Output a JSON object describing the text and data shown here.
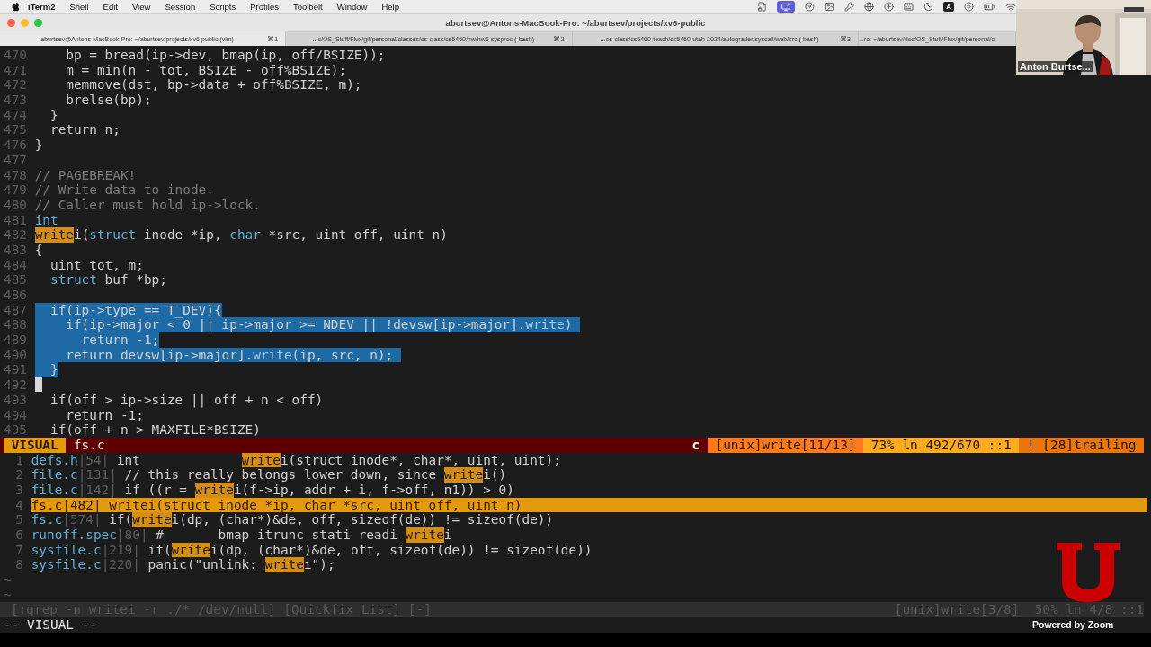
{
  "menu_bar": {
    "app": "iTerm2",
    "items": [
      "Shell",
      "Edit",
      "View",
      "Session",
      "Scripts",
      "Profiles",
      "Toolbelt",
      "Window",
      "Help"
    ],
    "input_source": "A"
  },
  "window": {
    "title": "aburtsev@Antons-MacBook-Pro: ~/aburtsev/projects/xv6-public",
    "tabs": [
      {
        "label": "aburtsev@Antons-MacBook-Pro: ~/aburtsev/projects/xv6-public (vim)",
        "shortcut": "⌘1",
        "selected": true
      },
      {
        "label": "...c/OS_Stuff/Flux/git/personal/classes/os-class/cs5460/hw/hw6-sysproc (-bash)",
        "shortcut": "⌘2",
        "selected": false
      },
      {
        "label": "...os-class/cs5460-teach/cs5460-utah-2024/autograder/syscall/web/src (-bash)",
        "shortcut": "⌘3",
        "selected": false
      },
      {
        "label": "...ro: ~/aburtsev/doc/OS_Stuff/Flux/git/personal/c",
        "selected": false
      }
    ]
  },
  "video": {
    "name": "Anton Burtse..."
  },
  "editor": {
    "lines": [
      {
        "number": "470",
        "selected": false,
        "cursor": false,
        "segments": [
          {
            "kind": "plain",
            "text": "    bp = bread(ip->dev, bmap(ip, off/BSIZE));"
          }
        ]
      },
      {
        "number": "471",
        "selected": false,
        "cursor": false,
        "segments": [
          {
            "kind": "plain",
            "text": "    m = min(n - tot, BSIZE - off%BSIZE);"
          }
        ]
      },
      {
        "number": "472",
        "selected": false,
        "cursor": false,
        "segments": [
          {
            "kind": "plain",
            "text": "    memmove(dst, bp->data + off%BSIZE, m);"
          }
        ]
      },
      {
        "number": "473",
        "selected": false,
        "cursor": false,
        "segments": [
          {
            "kind": "plain",
            "text": "    brelse(bp);"
          }
        ]
      },
      {
        "number": "474",
        "selected": false,
        "cursor": false,
        "segments": [
          {
            "kind": "plain",
            "text": "  }"
          }
        ]
      },
      {
        "number": "475",
        "selected": false,
        "cursor": false,
        "segments": [
          {
            "kind": "plain",
            "text": "  return n;"
          }
        ]
      },
      {
        "number": "476",
        "selected": false,
        "cursor": false,
        "segments": [
          {
            "kind": "plain",
            "text": "}"
          }
        ]
      },
      {
        "number": "477",
        "selected": false,
        "cursor": false
      },
      {
        "number": "478",
        "selected": false,
        "cursor": false,
        "segments": [
          {
            "kind": "comment",
            "text": "// PAGEBREAK!"
          }
        ]
      },
      {
        "number": "479",
        "selected": false,
        "cursor": false,
        "segments": [
          {
            "kind": "comment",
            "text": "// Write data to inode."
          }
        ]
      },
      {
        "number": "480",
        "selected": false,
        "cursor": false,
        "segments": [
          {
            "kind": "comment",
            "text": "// Caller must hold ip->lock."
          }
        ]
      },
      {
        "number": "481",
        "selected": false,
        "cursor": false,
        "segments": [
          {
            "kind": "type",
            "text": "int"
          }
        ]
      },
      {
        "number": "482",
        "selected": false,
        "cursor": false,
        "segments": [
          {
            "kind": "match",
            "text": "write"
          },
          {
            "kind": "plain",
            "text": "i("
          },
          {
            "kind": "type",
            "text": "struct"
          },
          {
            "kind": "plain",
            "text": " inode *ip, "
          },
          {
            "kind": "type",
            "text": "char"
          },
          {
            "kind": "plain",
            "text": " *src, uint off, uint n)"
          }
        ]
      },
      {
        "number": "483",
        "selected": false,
        "cursor": false,
        "segments": [
          {
            "kind": "plain",
            "text": "{"
          }
        ]
      },
      {
        "number": "484",
        "selected": false,
        "cursor": false,
        "segments": [
          {
            "kind": "plain",
            "text": "  uint tot, m;"
          }
        ]
      },
      {
        "number": "485",
        "selected": false,
        "cursor": false,
        "segments": [
          {
            "kind": "type",
            "text": "  struct"
          },
          {
            "kind": "plain",
            "text": " buf *bp;"
          }
        ]
      },
      {
        "number": "486",
        "selected": false,
        "cursor": false
      },
      {
        "number": "487",
        "selected": true,
        "cursor": false,
        "segments": [
          {
            "kind": "plain",
            "text": "  if(ip->type == T_DEV){"
          }
        ]
      },
      {
        "number": "488",
        "selected": true,
        "cursor": false,
        "segments": [
          {
            "kind": "plain",
            "text": "    if(ip->major < 0 || ip->major >= NDEV || !devsw[ip->major]."
          },
          {
            "kind": "dim",
            "text": "write"
          },
          {
            "kind": "plain",
            "text": ") "
          }
        ]
      },
      {
        "number": "489",
        "selected": true,
        "cursor": false,
        "segments": [
          {
            "kind": "plain",
            "text": "      return -1;"
          }
        ]
      },
      {
        "number": "490",
        "selected": true,
        "cursor": false,
        "segments": [
          {
            "kind": "plain",
            "text": "    return devsw[ip->major]."
          },
          {
            "kind": "dim",
            "text": "write"
          },
          {
            "kind": "plain",
            "text": "(ip, src, n); "
          }
        ]
      },
      {
        "number": "491",
        "selected": true,
        "cursor": false,
        "segments": [
          {
            "kind": "plain",
            "text": "  }"
          }
        ]
      },
      {
        "number": "492",
        "selected": false,
        "cursor": true
      },
      {
        "number": "493",
        "selected": false,
        "cursor": false,
        "segments": [
          {
            "kind": "plain",
            "text": "  if(off > ip->size || off + n < off)"
          }
        ]
      },
      {
        "number": "494",
        "selected": false,
        "cursor": false,
        "segments": [
          {
            "kind": "plain",
            "text": "    return -1;"
          }
        ]
      },
      {
        "number": "495",
        "selected": false,
        "cursor": false,
        "segments": [
          {
            "kind": "plain",
            "text": "  if(off + n > MAXFILE*BSIZE)"
          }
        ]
      }
    ]
  },
  "status_line": {
    "mode": "VISUAL",
    "file": "fs.c",
    "filetype": "c",
    "segments": [
      {
        "text": "[unix]write[11/13]",
        "color": "#ff7a1a"
      },
      {
        "text": "73% ln 492/670 ::1",
        "color": "#ffab1f"
      },
      {
        "text": "! [28]trailing",
        "color": "#e8760c"
      }
    ]
  },
  "quickfix": {
    "rows": [
      {
        "index": "1",
        "file": "defs.h",
        "location": "|54|",
        "selected": false,
        "segments": [
          {
            "kind": "plain",
            "text": " int             "
          },
          {
            "kind": "match",
            "text": "write"
          },
          {
            "kind": "plain",
            "text": "i(struct inode*, char*, uint, uint);"
          }
        ]
      },
      {
        "index": "2",
        "file": "file.c",
        "location": "|131|",
        "selected": false,
        "segments": [
          {
            "kind": "plain",
            "text": " // this really belongs lower down, since "
          },
          {
            "kind": "match",
            "text": "write"
          },
          {
            "kind": "plain",
            "text": "i()"
          }
        ]
      },
      {
        "index": "3",
        "file": "file.c",
        "location": "|142|",
        "selected": false,
        "segments": [
          {
            "kind": "plain",
            "text": " if ((r = "
          },
          {
            "kind": "match",
            "text": "write"
          },
          {
            "kind": "plain",
            "text": "i(f->ip, addr + i, f->off, n1)) > 0)"
          }
        ]
      },
      {
        "index": "4",
        "file": "fs.c",
        "location": "|482|",
        "selected": true,
        "segments": [
          {
            "kind": "plain",
            "text": " writei(struct inode *ip, char *src, uint off, uint n)"
          }
        ]
      },
      {
        "index": "5",
        "file": "fs.c",
        "location": "|574|",
        "selected": false,
        "segments": [
          {
            "kind": "plain",
            "text": " if("
          },
          {
            "kind": "match",
            "text": "write"
          },
          {
            "kind": "plain",
            "text": "i(dp, (char*)&de, off, sizeof(de)) != sizeof(de))"
          }
        ]
      },
      {
        "index": "6",
        "file": "runoff.spec",
        "location": "|80|",
        "selected": false,
        "segments": [
          {
            "kind": "plain",
            "text": " #       bmap itrunc stati readi "
          },
          {
            "kind": "match",
            "text": "write"
          },
          {
            "kind": "plain",
            "text": "i"
          }
        ]
      },
      {
        "index": "7",
        "file": "sysfile.c",
        "location": "|219|",
        "selected": false,
        "segments": [
          {
            "kind": "plain",
            "text": " if("
          },
          {
            "kind": "match",
            "text": "write"
          },
          {
            "kind": "plain",
            "text": "i(dp, (char*)&de, off, sizeof(de)) != sizeof(de))"
          }
        ]
      },
      {
        "index": "8",
        "file": "sysfile.c",
        "location": "|220|",
        "selected": false,
        "segments": [
          {
            "kind": "plain",
            "text": " panic(\"unlink: "
          },
          {
            "kind": "match",
            "text": "write"
          },
          {
            "kind": "plain",
            "text": "i\");"
          }
        ]
      }
    ],
    "empty_lines": [
      "~",
      "~"
    ],
    "status": {
      "title": "[:grep -n writei -r ./* /dev/null] [Quickfix List] [-]",
      "segments": [
        "[unix]write[3/8]",
        "50% ln 4/8 ::1"
      ]
    }
  },
  "command_line": "-- VISUAL --",
  "overlay": {
    "caption": "Powered by Zoom"
  }
}
